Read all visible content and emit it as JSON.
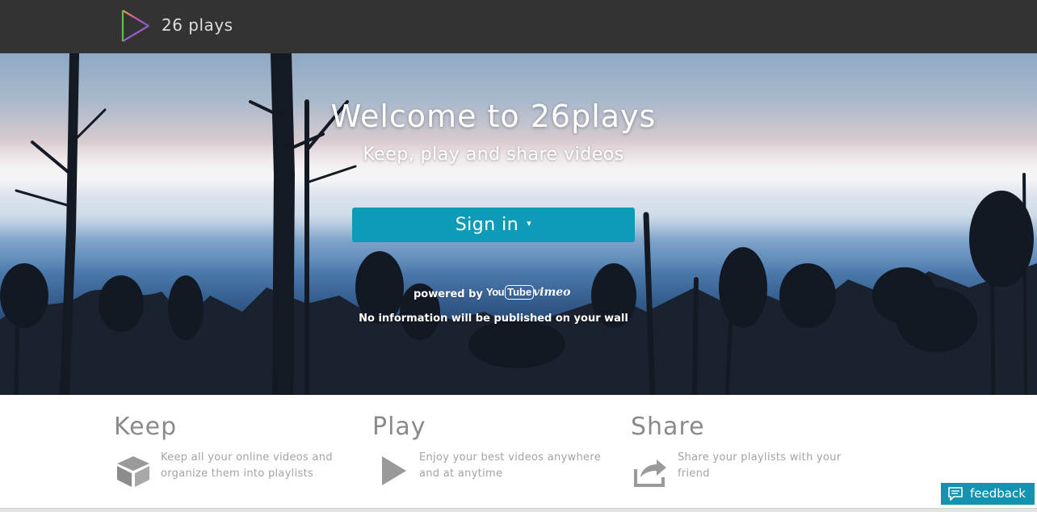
{
  "header": {
    "brand": "26 plays",
    "logo_icon": "play-triangle-logo-icon"
  },
  "hero": {
    "title": "Welcome to 26plays",
    "subtitle": "Keep, play and share videos",
    "signin_label": "Sign in",
    "signin_caret": "▾",
    "powered_by": "powered by",
    "youtube_logo": {
      "you": "You",
      "tube": "Tube"
    },
    "vimeo_logo": "vimeo",
    "notice": "No information will be published on your wall"
  },
  "features": [
    {
      "title": "Keep",
      "icon": "box-icon",
      "text": "Keep all your online videos and organize them into playlists"
    },
    {
      "title": "Play",
      "icon": "play-icon",
      "text": "Enjoy your best videos anywhere and at anytime"
    },
    {
      "title": "Share",
      "icon": "share-icon",
      "text": "Share your playlists with your friend"
    }
  ],
  "feedback": {
    "label": "feedback",
    "icon": "speech-bubble-icon"
  },
  "colors": {
    "topbar": "#333333",
    "accent": "#0e9bb7",
    "feedback": "#1393b0",
    "feature_title": "#8a8a8a",
    "feature_text": "#a3a3a3"
  }
}
